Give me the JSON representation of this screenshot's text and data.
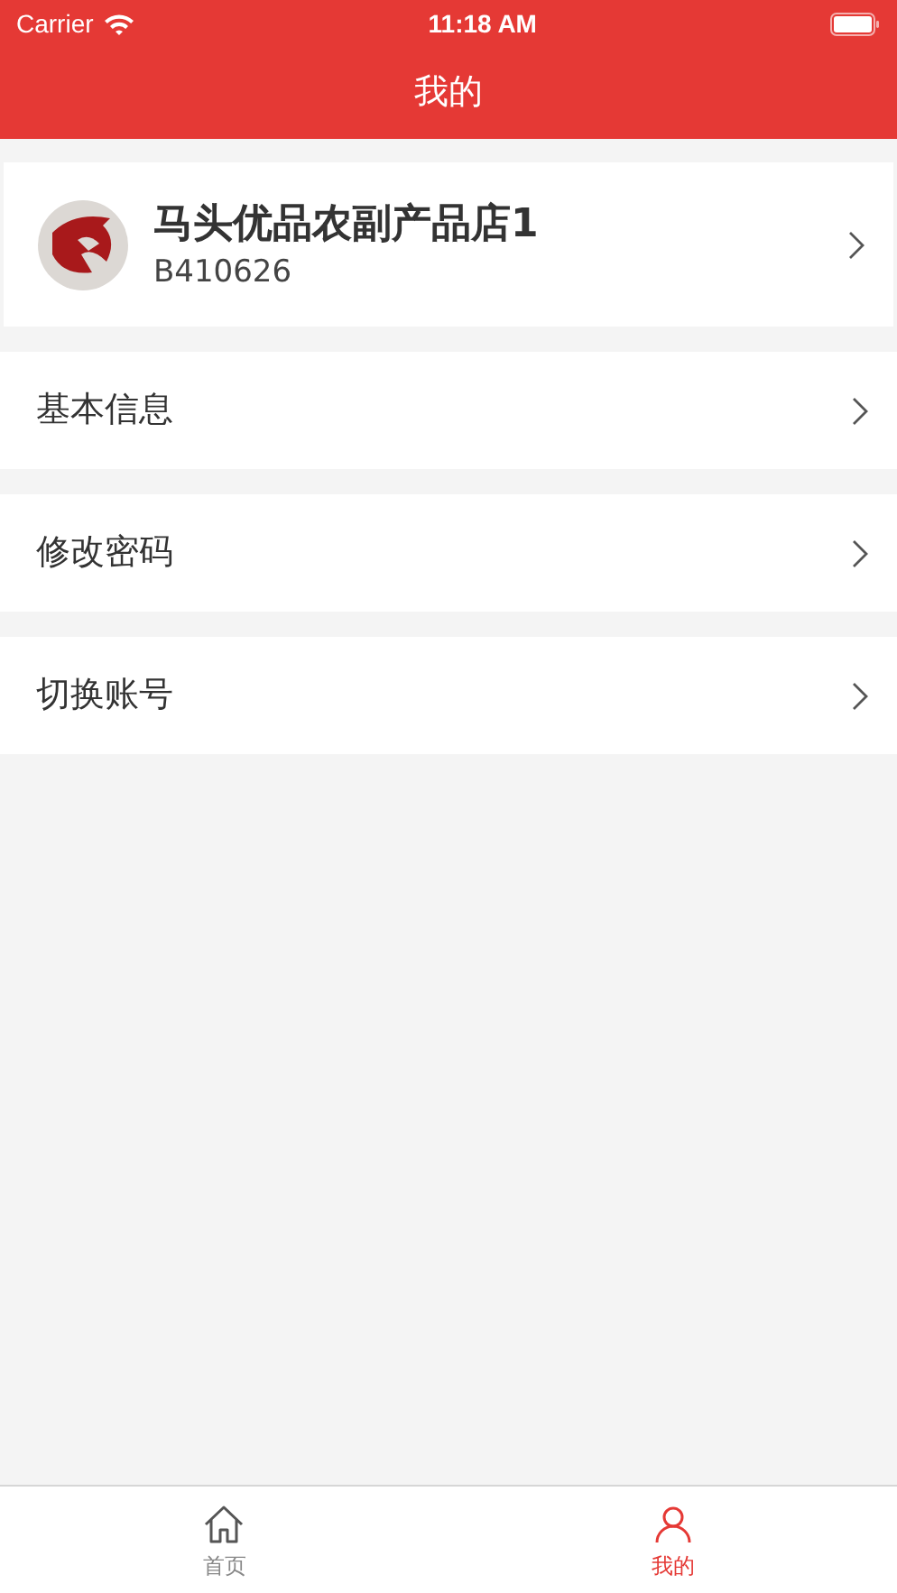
{
  "status_bar": {
    "carrier": "Carrier",
    "time": "11:18 AM"
  },
  "nav": {
    "title": "我的"
  },
  "profile": {
    "name": "马头优品农副产品店1",
    "code": "B410626"
  },
  "menu": [
    {
      "label": "基本信息"
    },
    {
      "label": "修改密码"
    },
    {
      "label": "切换账号"
    }
  ],
  "tabs": [
    {
      "label": "首页",
      "kind": "home",
      "selected": false
    },
    {
      "label": "我的",
      "kind": "user",
      "selected": true
    }
  ]
}
